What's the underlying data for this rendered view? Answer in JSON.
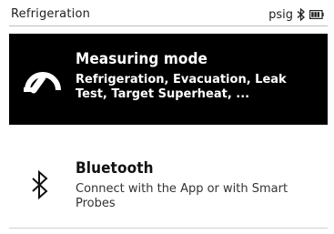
{
  "status_bar": {
    "title": "Refrigeration",
    "unit": "psig",
    "bluetooth_icon": "bluetooth-icon",
    "battery_icon": "battery-icon"
  },
  "menu": {
    "items": [
      {
        "icon": "gauge-icon",
        "title": "Measuring mode",
        "description": "Refrigeration, Evacuation, Leak Test, Target Superheat, ...",
        "selected": true
      },
      {
        "icon": "bluetooth-icon",
        "title": "Bluetooth",
        "description": "Connect with the App or with Smart Probes",
        "selected": false
      }
    ]
  },
  "colors": {
    "selected_bg": "#000000",
    "selected_fg": "#ffffff",
    "background": "#ffffff"
  }
}
